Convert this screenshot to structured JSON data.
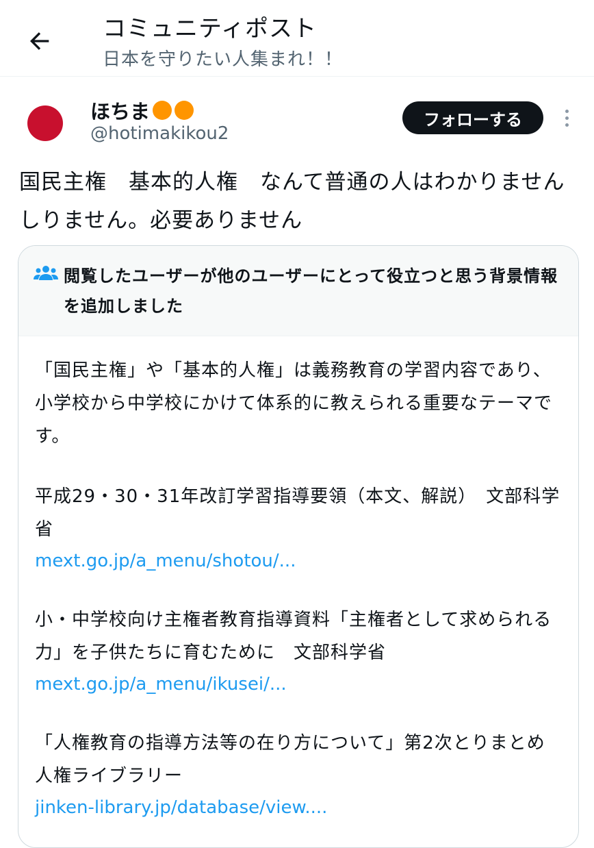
{
  "header": {
    "title": "コミュニティポスト",
    "subtitle": "日本を守りたい人集まれ！！"
  },
  "post": {
    "display_name": "ほちま",
    "handle": "@hotimakikou2",
    "follow_label": "フォローする",
    "text": "国民主権　基本的人権　なんて普通の人はわかりませんしりません。必要ありません"
  },
  "note": {
    "header": "閲覧したユーザーが他のユーザーにとって役立つと思う背景情報を追加しました",
    "paragraph": "「国民主権」や「基本的人権」は義務教育の学習内容であり、小学校から中学校にかけて体系的に教えられる重要なテーマです。",
    "references": [
      {
        "title": "平成29・30・31年改訂学習指導要領（本文、解説）　文部科学省",
        "link": "mext.go.jp/a_menu/shotou/..."
      },
      {
        "title": "小・中学校向け主権者教育指導資料「主権者として求められる力」を子供たちに育むために　文部科学省",
        "link": "mext.go.jp/a_menu/ikusei/..."
      },
      {
        "title": "「人権教育の指導方法等の在り方について」第2次とりまとめ　人権ライブラリー",
        "link": "jinken-library.jp/database/view...."
      }
    ]
  },
  "colors": {
    "link": "#1d9bf0",
    "muted": "#536471",
    "follow_bg": "#0f1419",
    "avatar_red": "#c8102e",
    "emoji_orange": "#ff9500"
  },
  "icons": {
    "back": "arrow-left-icon",
    "more": "vertical-dots-icon",
    "note": "people-icon"
  }
}
